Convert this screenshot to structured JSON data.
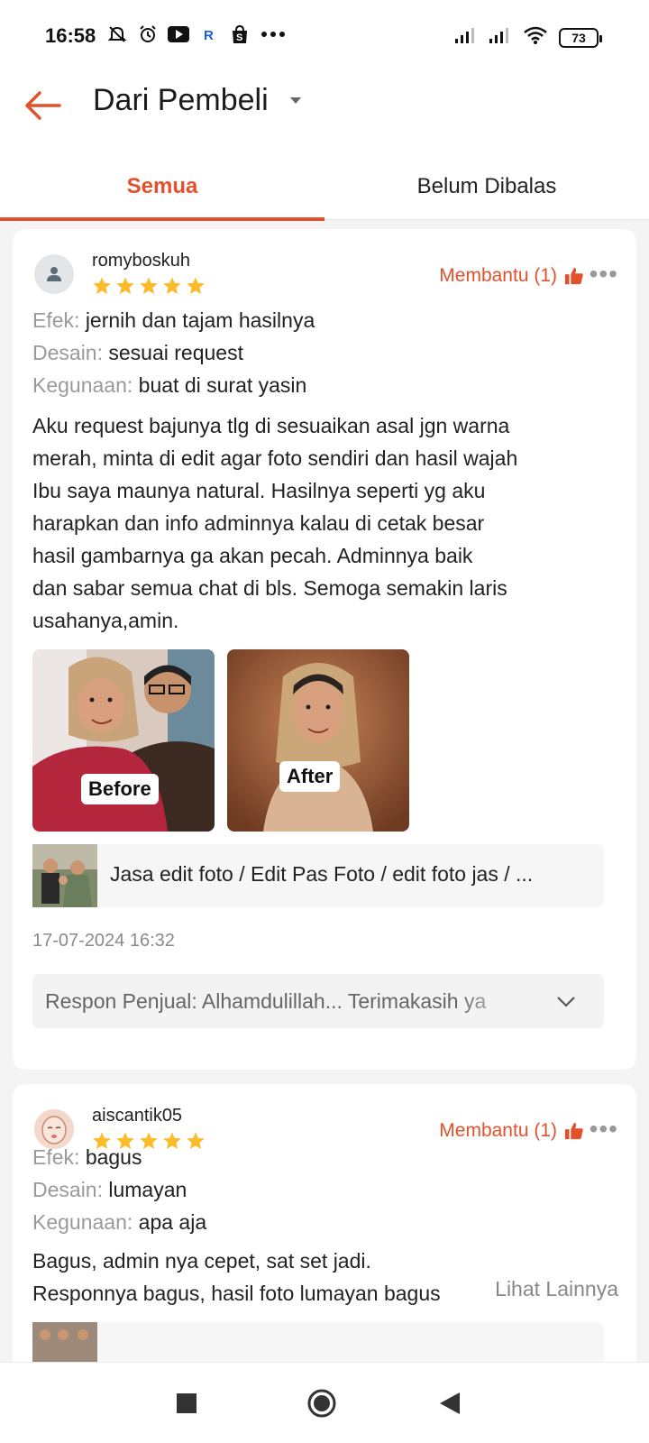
{
  "status_bar": {
    "time": "16:58",
    "battery": "73",
    "icons": [
      "muted-bell-icon",
      "alarm-icon",
      "youtube-icon",
      "r-app-icon",
      "shopee-icon",
      "more-dots-icon"
    ],
    "right_icons": [
      "signal-icon",
      "signal-icon",
      "wifi-icon",
      "battery-icon"
    ]
  },
  "header": {
    "title": "Dari Pembeli"
  },
  "tabs": [
    {
      "label": "Semua",
      "active": true
    },
    {
      "label": "Belum Dibalas",
      "active": false
    }
  ],
  "colors": {
    "accent": "#e2512b",
    "star": "#fbbb2a"
  },
  "reviews": [
    {
      "username": "romyboskuh",
      "rating": 5,
      "helpful": "Membantu (1)",
      "attributes": [
        {
          "key": "Efek:",
          "value": "jernih dan tajam hasilnya"
        },
        {
          "key": "Desain:",
          "value": "sesuai request"
        },
        {
          "key": "Kegunaan:",
          "value": "buat di surat yasin"
        }
      ],
      "text_lines": [
        "Aku request bajunya tlg di sesuaikan asal jgn warna",
        "merah, minta di edit agar foto sendiri dan hasil wajah",
        "Ibu saya maunya natural. Hasilnya seperti yg aku",
        "harapkan dan info adminnya kalau di cetak besar",
        "hasil gambarnya ga akan pecah. Adminnya baik",
        "dan sabar semua chat di bls. Semoga semakin laris",
        "usahanya,amin."
      ],
      "photos": [
        {
          "label": "Before"
        },
        {
          "label": "After"
        }
      ],
      "product": "Jasa edit foto / Edit Pas Foto / edit foto jas / ...",
      "date": "17-07-2024 16:32",
      "response": "Respon Penjual: Alhamdulillah... Terimakasih ya"
    },
    {
      "username": "aiscantik05",
      "rating": 5,
      "helpful": "Membantu (1)",
      "attributes": [
        {
          "key": "Efek:",
          "value": "bagus"
        },
        {
          "key": "Desain:",
          "value": "lumayan"
        },
        {
          "key": "Kegunaan:",
          "value": "apa aja"
        }
      ],
      "text_lines": [
        "Bagus, admin nya cepet, sat set jadi.",
        "Responnya bagus, hasil foto lumayan bagus"
      ],
      "see_more": "Lihat Lainnya"
    }
  ]
}
